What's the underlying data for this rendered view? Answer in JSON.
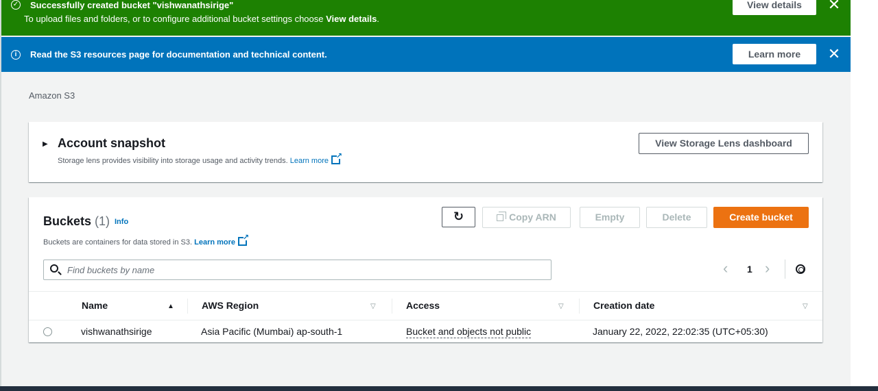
{
  "success_flash": {
    "title": "Successfully created bucket \"vishwanathsirige\"",
    "subtitle_prefix": "To upload files and folders, or to configure additional bucket settings choose ",
    "subtitle_bold": "View details",
    "subtitle_suffix": ".",
    "button": "View details",
    "close": "✕",
    "icon": "check-circle-icon",
    "color": "#1d8102"
  },
  "info_flash": {
    "title": "Read the S3 resources page for documentation and technical content.",
    "button": "Learn more",
    "close": "✕",
    "icon": "info-circle-icon",
    "color": "#0073bb"
  },
  "breadcrumb": "Amazon S3",
  "snapshot": {
    "caret": "▶",
    "title": "Account snapshot",
    "description": "Storage lens provides visibility into storage usage and activity trends. ",
    "learn_more": "Learn more",
    "button": "View Storage Lens dashboard"
  },
  "buckets": {
    "title": "Buckets",
    "count": "(1)",
    "info": "Info",
    "description": "Buckets are containers for data stored in S3. ",
    "learn_more": "Learn more",
    "refresh": "↻",
    "copy_arn": "Copy ARN",
    "empty": "Empty",
    "delete": "Delete",
    "create": "Create bucket",
    "create_color": "#ec7211",
    "search_placeholder": "Find buckets by name",
    "pager": {
      "prev": "‹",
      "page": "1",
      "next": "›"
    },
    "columns": [
      {
        "label": "Name",
        "sort": "▲"
      },
      {
        "label": "AWS Region",
        "sort": "▽"
      },
      {
        "label": "Access",
        "sort": "▽"
      },
      {
        "label": "Creation date",
        "sort": "▽"
      }
    ],
    "rows": [
      {
        "name": "vishwanathsirige",
        "region": "Asia Pacific (Mumbai) ap-south-1",
        "access": "Bucket and objects not public",
        "created": "January 22, 2022, 22:02:35 (UTC+05:30)"
      }
    ]
  }
}
